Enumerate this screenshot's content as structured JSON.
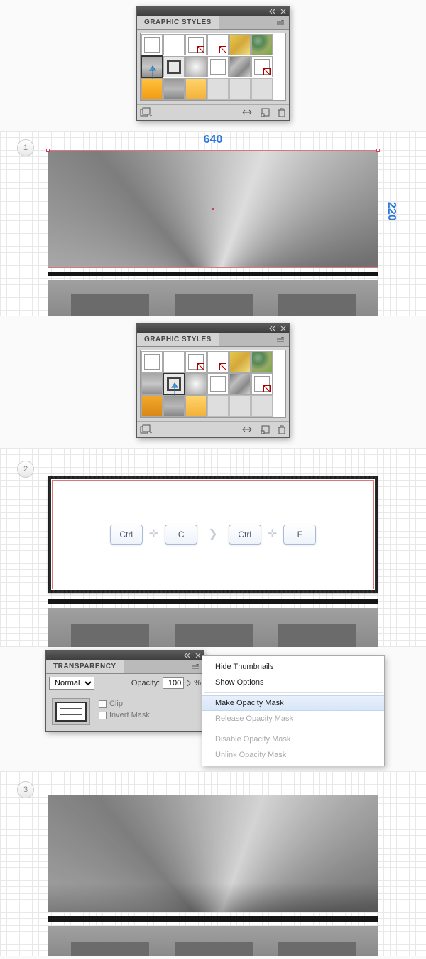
{
  "panels": {
    "graphic_styles_title": "GRAPHIC STYLES",
    "transparency_title": "TRANSPARENCY"
  },
  "transparency": {
    "blend": "Normal",
    "opacity_label": "Opacity:",
    "opacity_value": "100",
    "pct": "%",
    "clip": "Clip",
    "invert": "Invert Mask"
  },
  "menu": {
    "hide_thumbs": "Hide Thumbnails",
    "show_opts": "Show Options",
    "make_mask": "Make Opacity Mask",
    "release_mask": "Release Opacity Mask",
    "disable_mask": "Disable Opacity Mask",
    "unlink_mask": "Unlink Opacity Mask"
  },
  "dims": {
    "w": "640",
    "h": "220"
  },
  "keys": {
    "ctrl": "Ctrl",
    "c": "C",
    "f": "F"
  },
  "steps": {
    "s1": "1",
    "s2": "2",
    "s3": "3"
  }
}
